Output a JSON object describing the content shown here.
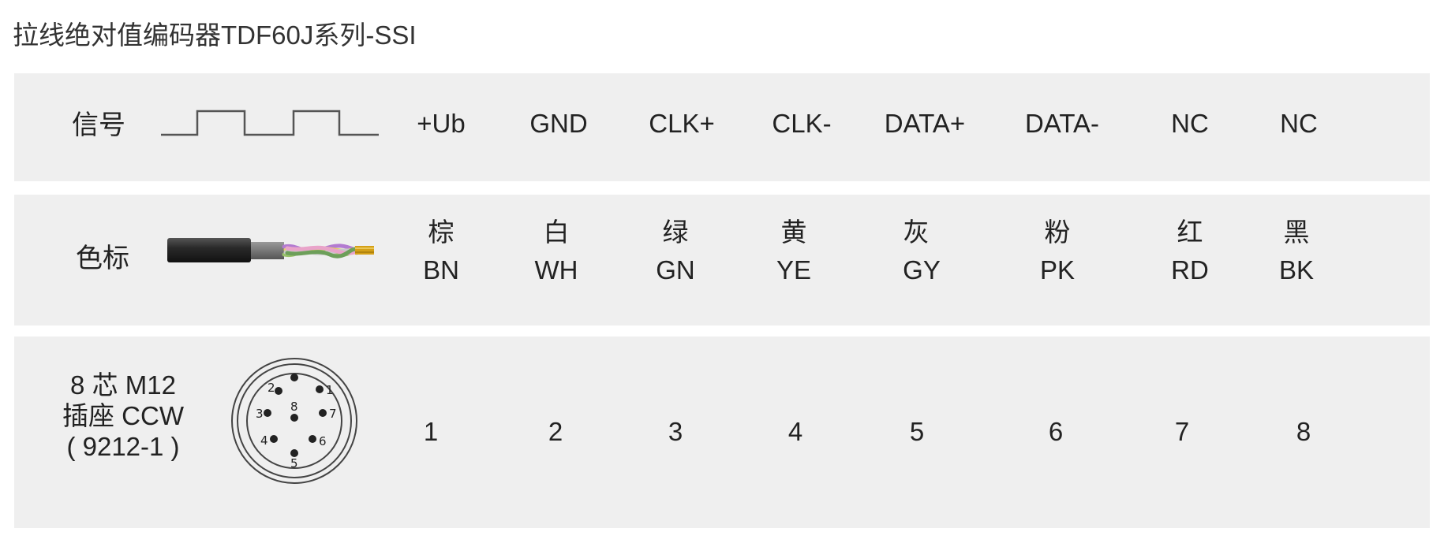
{
  "title": "拉线绝对值编码器TDF60J系列-SSI",
  "signal_row": {
    "label": "信号",
    "pins": [
      "+Ub",
      "GND",
      "CLK+",
      "CLK-",
      "DATA+",
      "DATA-",
      "NC",
      "NC"
    ]
  },
  "color_row": {
    "label": "色标",
    "colors": [
      {
        "cn": "棕",
        "en": "BN"
      },
      {
        "cn": "白",
        "en": "WH"
      },
      {
        "cn": "绿",
        "en": "GN"
      },
      {
        "cn": "黄",
        "en": "YE"
      },
      {
        "cn": "灰",
        "en": "GY"
      },
      {
        "cn": "粉",
        "en": "PK"
      },
      {
        "cn": "红",
        "en": "RD"
      },
      {
        "cn": "黑",
        "en": "BK"
      }
    ]
  },
  "connector_row": {
    "label_line1": "8 芯 M12",
    "label_line2": "插座 CCW",
    "label_line3": "( 9212-1 )",
    "pin_numbers": [
      "1",
      "2",
      "3",
      "4",
      "5",
      "6",
      "7",
      "8"
    ],
    "diagram_pin_labels": [
      "1",
      "2",
      "3",
      "4",
      "5",
      "6",
      "7",
      "8"
    ]
  }
}
